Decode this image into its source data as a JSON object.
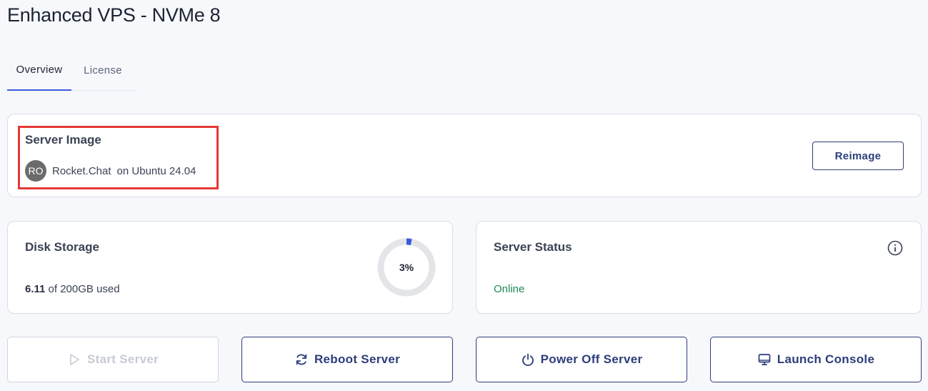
{
  "page": {
    "title": "Enhanced VPS - NVMe 8"
  },
  "tabs": [
    {
      "label": "Overview",
      "active": true
    },
    {
      "label": "License",
      "active": false
    }
  ],
  "server_image": {
    "title": "Server Image",
    "avatar_initials": "RO",
    "name": "Rocket.Chat",
    "os": "on Ubuntu 24.04",
    "reimage_label": "Reimage"
  },
  "disk": {
    "title": "Disk Storage",
    "used": "6.11",
    "of_total": " of 200GB used",
    "percent_label": "3%",
    "percent": 3
  },
  "status": {
    "title": "Server Status",
    "value": "Online",
    "info_icon": "info-icon"
  },
  "actions": {
    "start": {
      "label": "Start Server",
      "icon": "play-icon",
      "disabled": true
    },
    "reboot": {
      "label": "Reboot Server",
      "icon": "refresh-icon"
    },
    "power": {
      "label": "Power Off Server",
      "icon": "power-icon"
    },
    "console": {
      "label": "Launch Console",
      "icon": "monitor-icon"
    }
  },
  "colors": {
    "accent": "#2c3e7a",
    "online": "#1e8a57",
    "highlight": "#e53935",
    "progress": "#3b5bdb"
  }
}
